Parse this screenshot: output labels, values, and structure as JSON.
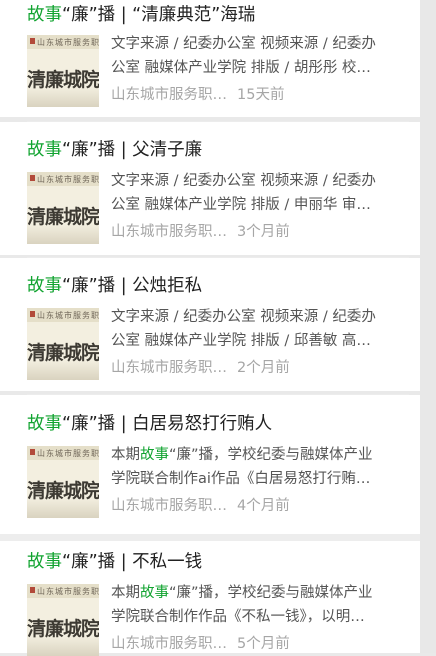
{
  "articles": [
    {
      "title_prefix": "故事",
      "title_rest": "“廉”播 | “清廉典范”海瑞",
      "summary_line1": "文字来源 / 纪委办公室 视频来源 / 纪委办",
      "summary_line2": "公室 融媒体产业学院 排版 / 胡彤彤 校…",
      "source": "山东城市服务职…",
      "time": "15天前",
      "thumb_calligraphy": "山东城市服务职业学院",
      "thumb_text": "清廉城院"
    },
    {
      "title_prefix": "故事",
      "title_rest": "“廉”播 | 父清子廉",
      "summary_line1": "文字来源 / 纪委办公室 视频来源 / 纪委办",
      "summary_line2": "公室 融媒体产业学院 排版 / 申丽华 审…",
      "source": "山东城市服务职…",
      "time": "3个月前",
      "thumb_calligraphy": "山东城市服务职业学院",
      "thumb_text": "清廉城院"
    },
    {
      "title_prefix": "故事",
      "title_rest": "“廉”播 | 公烛拒私",
      "summary_line1": "文字来源 / 纪委办公室 视频来源 / 纪委办",
      "summary_line2": "公室 融媒体产业学院 排版 / 邱善敏 高…",
      "source": "山东城市服务职…",
      "time": "2个月前",
      "thumb_calligraphy": "山东城市服务职业学院",
      "thumb_text": "清廉城院"
    },
    {
      "title_prefix": "故事",
      "title_rest": "“廉”播 | 白居易怒打行贿人",
      "summary_line1_pre": "本期",
      "summary_line1_kw": "故事",
      "summary_line1_post": "“廉”播，学校纪委与融媒体产业",
      "summary_line2": "学院联合制作ai作品《白居易怒打行贿…",
      "source": "山东城市服务职…",
      "time": "4个月前",
      "thumb_calligraphy": "山东城市服务职业学院",
      "thumb_text": "清廉城院"
    },
    {
      "title_prefix": "故事",
      "title_rest": "“廉”播 | 不私一钱",
      "summary_line1_pre": "本期",
      "summary_line1_kw": "故事",
      "summary_line1_post": "“廉”播，学校纪委与融媒体产业",
      "summary_line2": "学院联合制作作品《不私一钱》，以明…",
      "source": "山东城市服务职…",
      "time": "5个月前",
      "thumb_calligraphy": "山东城市服务职业学院",
      "thumb_text": "清廉城院"
    }
  ],
  "colors": {
    "keyword_green": "#10a32f",
    "meta_gray": "#a6a6a6",
    "page_bg": "#ededed"
  }
}
